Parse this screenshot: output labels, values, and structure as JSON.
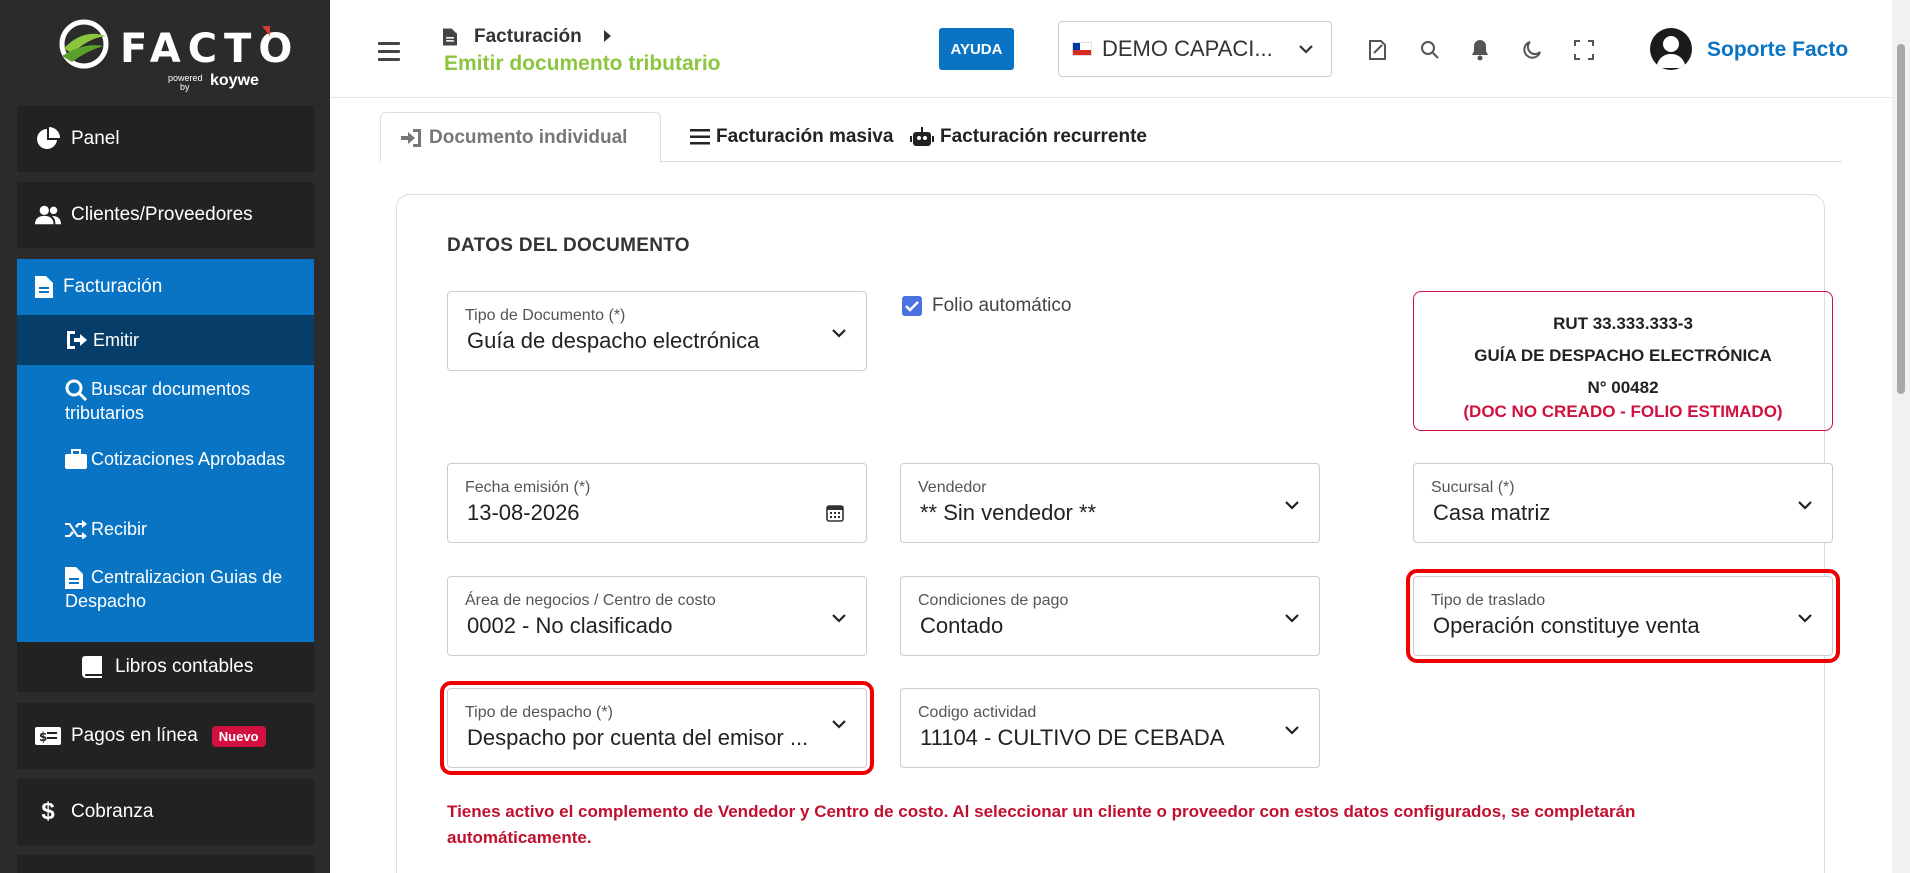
{
  "brand": {
    "name": "FACTO",
    "powered": "powered",
    "by": "by",
    "partner": "koywe"
  },
  "sidebar": {
    "panel": "Panel",
    "clientes": "Clientes/Proveedores",
    "facturacion": "Facturación",
    "submenu": {
      "emitir": "Emitir",
      "buscar": "Buscar documentos tributarios",
      "cotizaciones": "Cotizaciones Aprobadas",
      "recibir": "Recibir",
      "centralizacion": "Centralizacion Guias de Despacho"
    },
    "libros": "Libros contables",
    "pagos": "Pagos en línea",
    "pagos_badge": "Nuevo",
    "cobranza": "Cobranza"
  },
  "header": {
    "breadcrumb_parent": "Facturación",
    "breadcrumb_current": "Emitir documento tributario",
    "help_button": "AYUDA",
    "company": "DEMO CAPACI...",
    "user_name": "Soporte Facto"
  },
  "tabs": {
    "individual": "Documento individual",
    "masiva": "Facturación masiva",
    "recurrente": "Facturación recurrente"
  },
  "form": {
    "section_title": "DATOS DEL DOCUMENTO",
    "tipo_documento": {
      "label": "Tipo de Documento (*)",
      "value": "Guía de despacho electrónica"
    },
    "folio_automatico": "Folio automático",
    "doc_summary": {
      "rut": "RUT 33.333.333-3",
      "tipo": "GUÍA DE DESPACHO ELECTRÓNICA",
      "numero": "N° 00482",
      "estado": "(DOC NO CREADO - FOLIO ESTIMADO)"
    },
    "fecha": {
      "label": "Fecha emisión (*)",
      "value": "13-08-2026"
    },
    "vendedor": {
      "label": "Vendedor",
      "value": "** Sin vendedor **"
    },
    "sucursal": {
      "label": "Sucursal (*)",
      "value": "Casa matriz"
    },
    "area": {
      "label": "Área de negocios / Centro de costo",
      "value": "0002 - No clasificado"
    },
    "condiciones": {
      "label": "Condiciones de pago",
      "value": "Contado"
    },
    "traslado": {
      "label": "Tipo de traslado",
      "value": "Operación constituye venta"
    },
    "despacho": {
      "label": "Tipo de despacho (*)",
      "value": "Despacho por cuenta del emisor ..."
    },
    "actividad": {
      "label": "Codigo actividad",
      "value": "11104 - CULTIVO DE CEBADA"
    },
    "notice": "Tienes activo el complemento de Vendedor y Centro de costo. Al seleccionar un cliente o proveedor con estos datos configurados, se completarán automáticamente."
  },
  "colors": {
    "accent_blue": "#0a74c4",
    "brand_green": "#8cc63f",
    "alert_red": "#d1103f",
    "sidebar_bg": "#2b2b2b"
  }
}
